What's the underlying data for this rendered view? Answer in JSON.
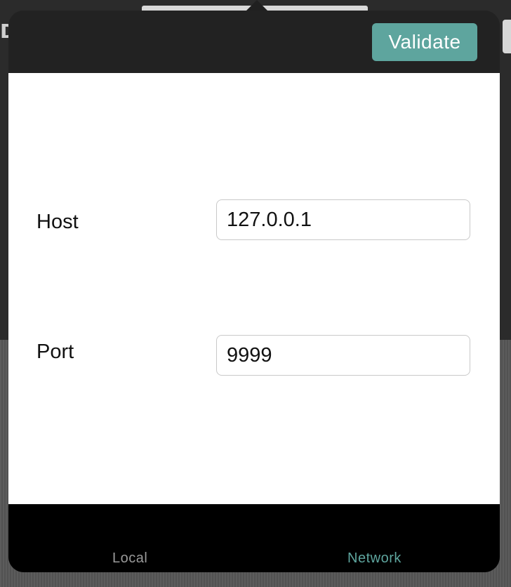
{
  "background": {
    "left_fragment": "D"
  },
  "popover": {
    "validate_label": "Validate"
  },
  "form": {
    "host": {
      "label": "Host",
      "value": "127.0.0.1"
    },
    "port": {
      "label": "Port",
      "value": "9999"
    }
  },
  "tabs": [
    {
      "label": "Local",
      "selected": false
    },
    {
      "label": "Network",
      "selected": true
    }
  ],
  "colors": {
    "accent": "#5ea59e",
    "nav_background": "#222222",
    "tab_bar_background": "#000000",
    "tab_inactive": "#9a9a9a"
  }
}
